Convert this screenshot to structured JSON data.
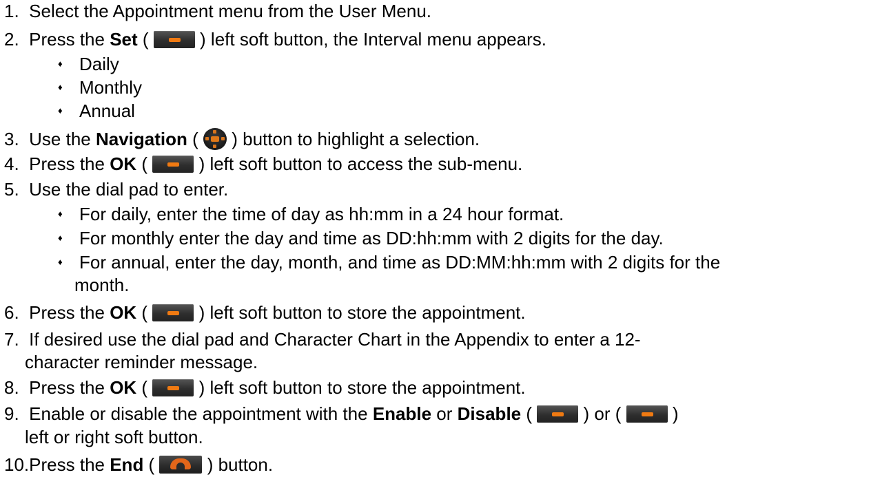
{
  "steps": [
    {
      "num": "1.",
      "text": "Select the Appointment menu from the User Menu."
    },
    {
      "num": "2.",
      "a": "Press the ",
      "b": "Set",
      "c": " (",
      "d": ") left soft button, the Interval menu appears."
    },
    {
      "num": "3.",
      "a": "Use the ",
      "b": "Navigation",
      "c": " (",
      "d": ") button to highlight a selection."
    },
    {
      "num": "4.",
      "a": "Press the ",
      "b": "OK",
      "c": " (",
      "d": ") left soft button to access the sub-menu."
    },
    {
      "num": "5.",
      "text": "Use the dial pad to enter."
    },
    {
      "num": "6.",
      "a": "Press the ",
      "b": "OK",
      "c": " (",
      "d": ") left soft button to store the appointment."
    },
    {
      "num": "7.",
      "line1": "If desired use the dial pad and Character Chart in the Appendix to enter a 12-",
      "line2": "character reminder message."
    },
    {
      "num": "8.",
      "a": "Press the ",
      "b": "OK",
      "c": " (",
      "d": ") left soft button to store the appointment."
    },
    {
      "num": "9.",
      "a": "Enable or disable the appointment with the ",
      "b": "Enable",
      "c": " or ",
      "e": "Disable",
      "f": " (",
      "g": ") or (",
      "h": ")",
      "line2": "left or right soft button."
    },
    {
      "num": "10.",
      "a": "Press the ",
      "b": "End",
      "c": " (",
      "d": ") button."
    }
  ],
  "interval_options": [
    "Daily",
    "Monthly",
    "Annual"
  ],
  "dial_pad_notes": [
    "For daily, enter the time of day as hh:mm in a 24 hour format.",
    "For monthly enter the day and time as DD:hh:mm with 2 digits for the day.",
    "For annual, enter the day, month, and time as DD:MM:hh:mm with 2 digits for the"
  ],
  "dial_pad_note_continuation": "month.",
  "bullet_glyph": "♦",
  "icons": {
    "soft_button": "soft-button-icon",
    "navigation_button": "navigation-button-icon",
    "end_button": "end-button-icon",
    "accent_color": "#f07a12"
  }
}
